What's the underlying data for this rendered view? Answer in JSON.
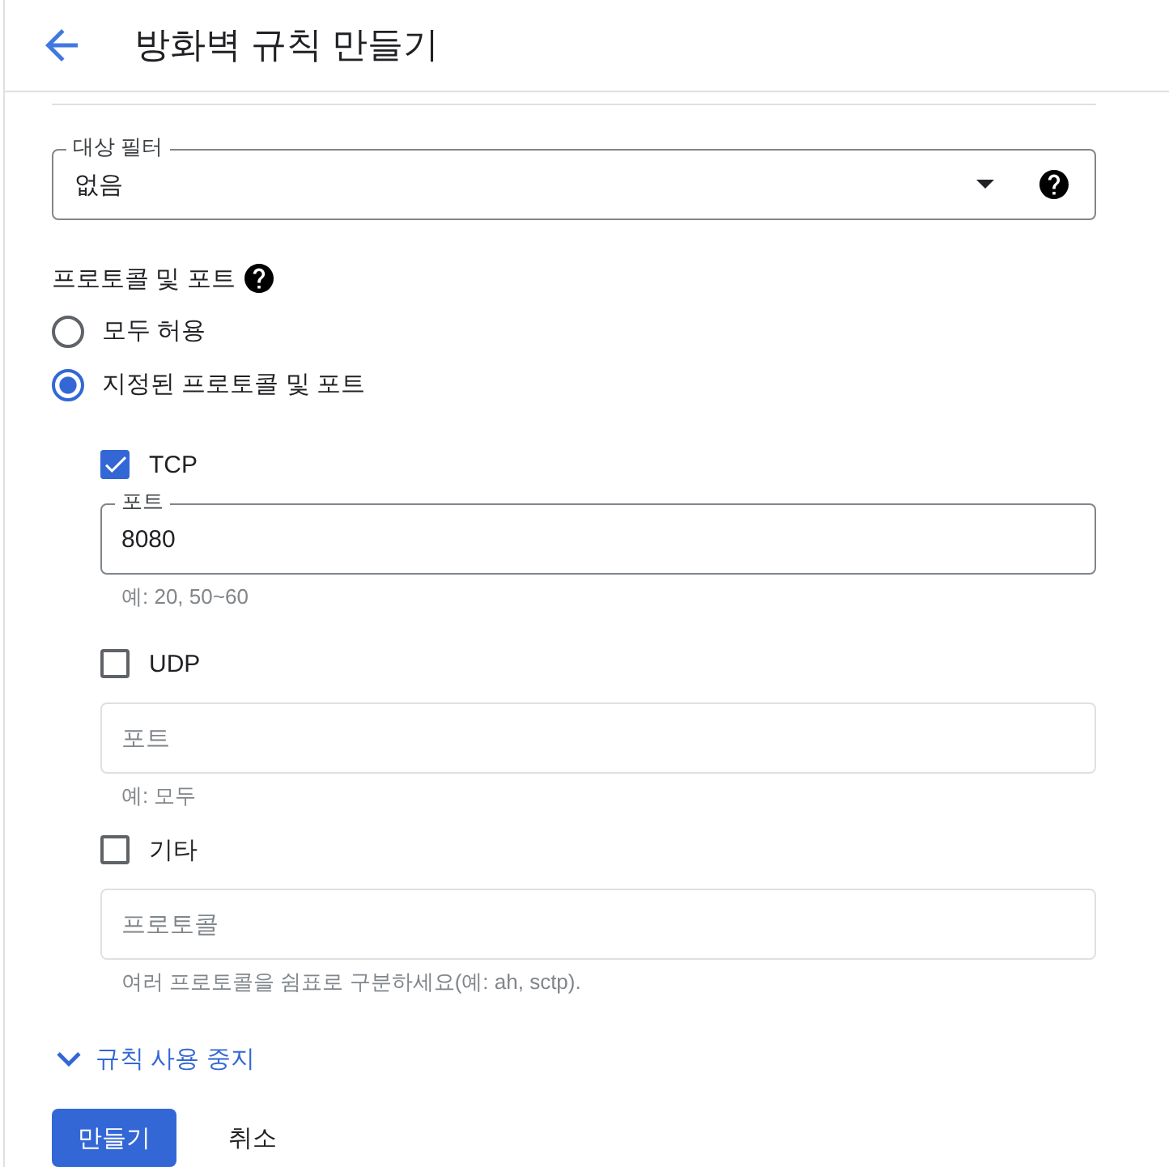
{
  "header": {
    "title": "방화벽 규칙 만들기"
  },
  "target_filter": {
    "label": "대상 필터",
    "value": "없음"
  },
  "protocols": {
    "title": "프로토콜 및 포트",
    "options": [
      {
        "label": "모두 허용",
        "selected": false
      },
      {
        "label": "지정된 프로토콜 및 포트",
        "selected": true
      }
    ],
    "entries": [
      {
        "label": "TCP",
        "checked": true,
        "field": {
          "label": "포트",
          "value": "8080"
        },
        "hint": "예: 20, 50~60"
      },
      {
        "label": "UDP",
        "checked": false,
        "field": {
          "placeholder": "포트"
        },
        "hint": "예: 모두"
      },
      {
        "label": "기타",
        "checked": false,
        "field": {
          "placeholder": "프로토콜"
        },
        "hint": "여러 프로토콜을 쉼표로 구분하세요(예: ah, sctp)."
      }
    ]
  },
  "disable_rule": {
    "label": "규칙 사용 중지",
    "expanded": false
  },
  "buttons": [
    {
      "label": "만들기",
      "kind": "primary"
    },
    {
      "label": "취소",
      "kind": "text"
    }
  ]
}
